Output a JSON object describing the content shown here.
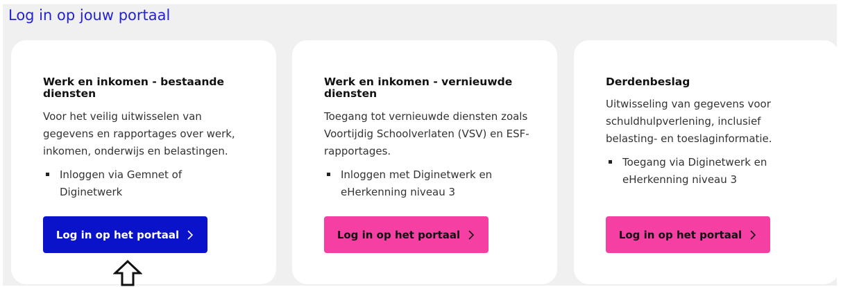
{
  "page_title": "Log in op jouw portaal",
  "cards": [
    {
      "title": "Werk en inkomen - bestaande diensten",
      "description": "Voor het veilig uitwisselen van gegevens en rapportages over werk, inkomen, onderwijs en belastingen.",
      "bullet": "Inloggen via Gemnet of Diginetwerk",
      "button_label": "Log in op het portaal",
      "button_color": "#0a13c9",
      "button_text_color": "#ffffff"
    },
    {
      "title": "Werk en inkomen - vernieuwde diensten",
      "description": "Toegang tot vernieuwde diensten zoals Voortijdig Schoolverlaten (VSV) en ESF-rapportages.",
      "bullet": "Inloggen met Diginetwerk en eHerkenning niveau 3",
      "button_label": "Log in op het portaal",
      "button_color": "#f53fa3",
      "button_text_color": "#111111"
    },
    {
      "title": "Derdenbeslag",
      "description": "Uitwisseling van gegevens voor schuldhulpverlening, inclusief belasting- en toeslaginformatie.",
      "bullet": "Toegang via Diginetwerk en eHerkenning niveau 3",
      "button_label": "Log in op het portaal",
      "button_color": "#f53fa3",
      "button_text_color": "#111111"
    }
  ],
  "icons": {
    "button_icon": "chevron-right-icon",
    "pointer_icon": "up-arrow-icon"
  },
  "colors": {
    "title": "#2323d6",
    "background": "#f0f0f0",
    "card": "#ffffff"
  }
}
